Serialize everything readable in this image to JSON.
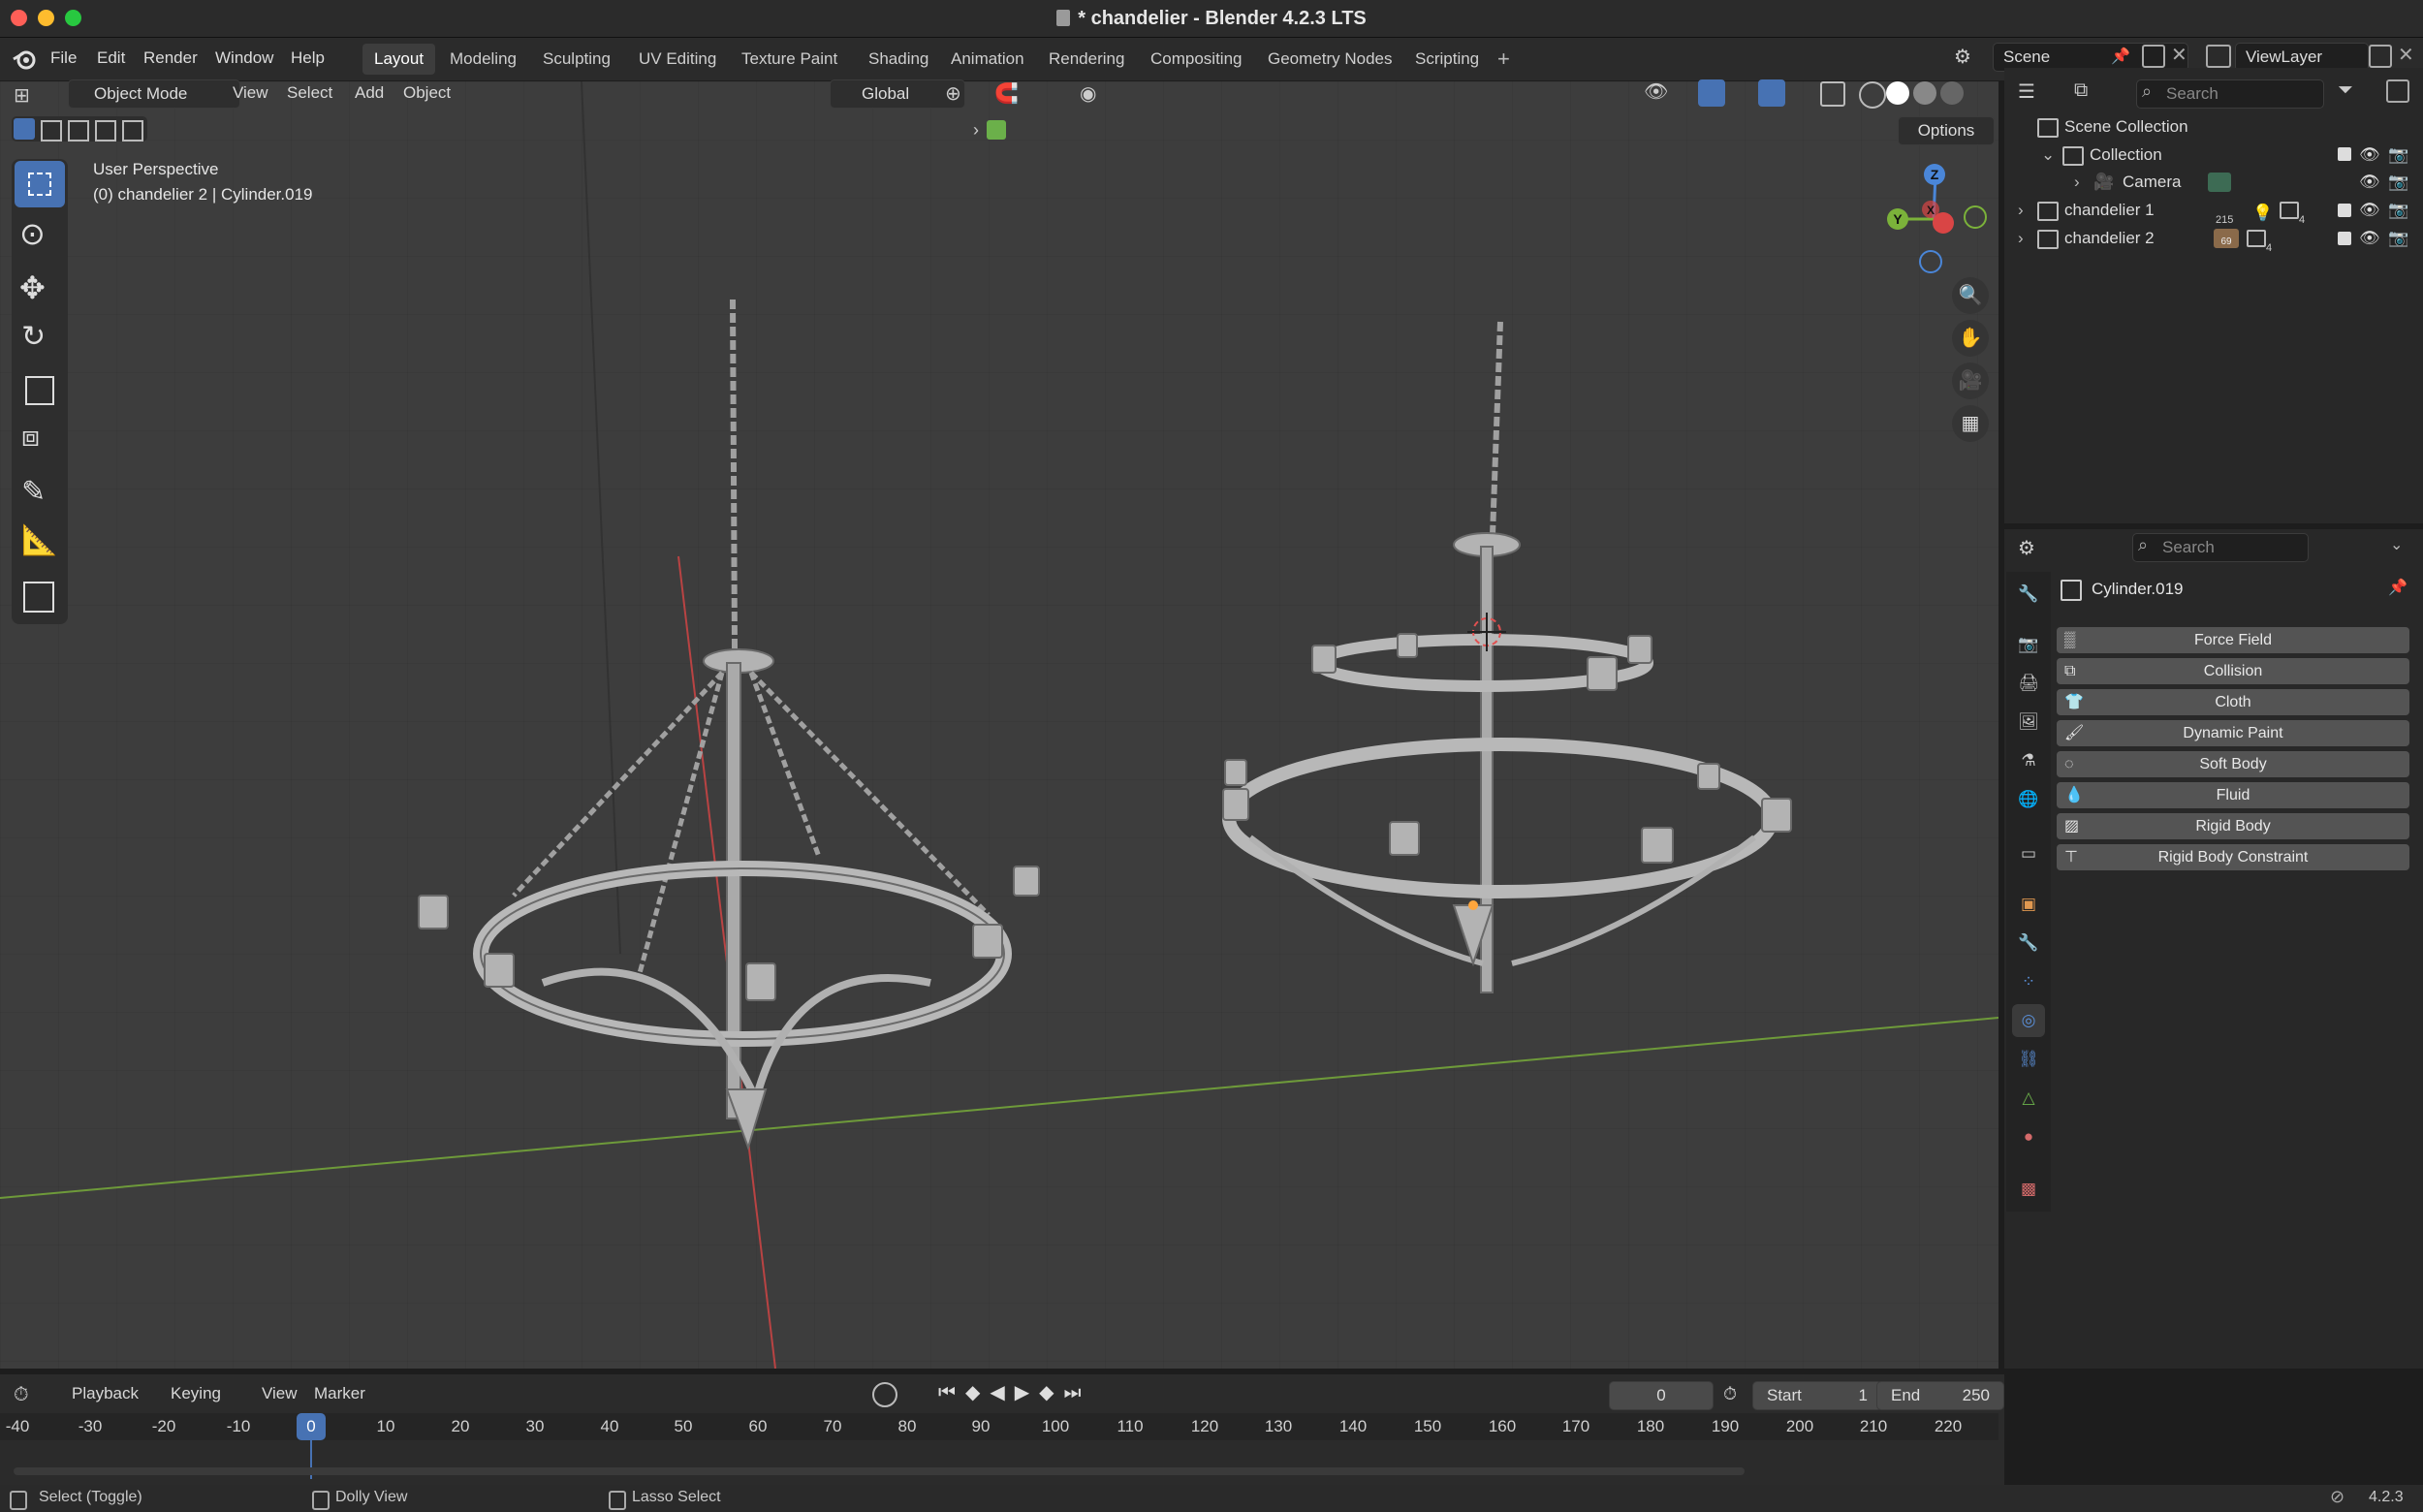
{
  "window": {
    "title": "* chandelier - Blender 4.2.3 LTS"
  },
  "menus": [
    "File",
    "Edit",
    "Render",
    "Window",
    "Help"
  ],
  "workspaces": [
    "Layout",
    "Modeling",
    "Sculpting",
    "UV Editing",
    "Texture Paint",
    "Shading",
    "Animation",
    "Rendering",
    "Compositing",
    "Geometry Nodes",
    "Scripting"
  ],
  "active_workspace": "Layout",
  "scene": {
    "name": "Scene",
    "view_layer": "ViewLayer"
  },
  "viewport_header": {
    "mode": "Object Mode",
    "menus": [
      "View",
      "Select",
      "Add",
      "Object"
    ],
    "transform_orientation": "Global",
    "options_label": "Options"
  },
  "viewport_overlay": {
    "perspective": "User Perspective",
    "active_object": "(0) chandelier 2 | Cylinder.019"
  },
  "gizmo": {
    "x": "X",
    "y": "Y",
    "z": "Z"
  },
  "outliner": {
    "search_placeholder": "Search",
    "rows": [
      {
        "label": "Scene Collection"
      },
      {
        "label": "Collection"
      },
      {
        "label": "Camera"
      },
      {
        "label": "chandelier 1",
        "badge1": "215",
        "badge2": "4"
      },
      {
        "label": "chandelier 2",
        "badge1": "69",
        "badge2": "4"
      }
    ]
  },
  "properties": {
    "search_placeholder": "Search",
    "object_name": "Cylinder.019",
    "physics_buttons": [
      "Force Field",
      "Collision",
      "Cloth",
      "Dynamic Paint",
      "Soft Body",
      "Fluid",
      "Rigid Body",
      "Rigid Body Constraint"
    ]
  },
  "timeline": {
    "menus": [
      "Playback",
      "Keying",
      "View",
      "Marker"
    ],
    "current_frame": "0",
    "start_label": "Start",
    "start": "1",
    "end_label": "End",
    "end": "250",
    "ticks": [
      "-40",
      "-30",
      "-20",
      "-10",
      "0",
      "10",
      "20",
      "30",
      "40",
      "50",
      "60",
      "70",
      "80",
      "90",
      "100",
      "110",
      "120",
      "130",
      "140",
      "150",
      "160",
      "170",
      "180",
      "190",
      "200",
      "210",
      "220"
    ]
  },
  "statusbar": {
    "items": [
      "Select (Toggle)",
      "Dolly View",
      "Lasso Select"
    ],
    "version": "4.2.3"
  },
  "colors": {
    "accent": "#4772b3",
    "x_axis": "#d94545",
    "y_axis": "#7bb23a",
    "z_axis": "#4a86d8"
  }
}
